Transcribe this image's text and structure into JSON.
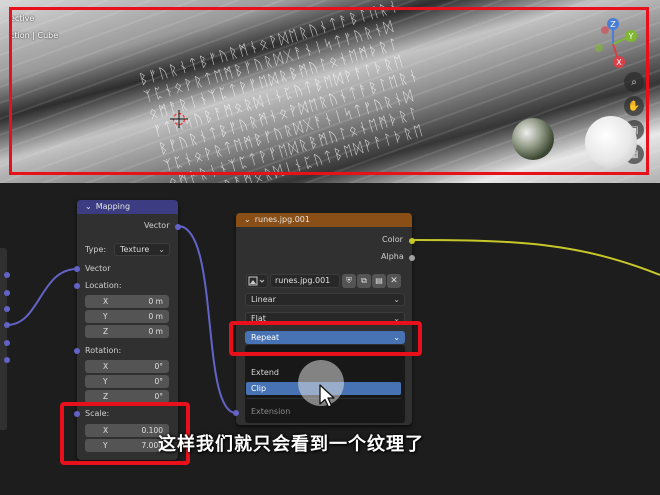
{
  "viewport": {
    "title": "ective",
    "subtitle": "ction | Cube",
    "runes_text": "ᛒᚠᚢᚱᚾᛏᛒᚠᚢᚱᛗᚾᛟᚹᛞᛖᚱᚢᚾᛏᚨᛒᛚᛖᚱᚾ\nᛉᛈᚾᛟᚹᚱᛏᛖᛗᛒᚠᚢᚱᛞᚷᚨᚾᛁᛋᛏᚠᚢᚱᚾᛞ\nᛟᛗᚨᚱᛁᚾᛉᛈᛏᚹᚠᛖᛞᚱᛒᛗᚢᛚᛟᚾᛖᛗᚦᚱᛚ\nᚠᛏᛖᛋᚢᛒᚨᛗᛟᚱᛞᛁᚾᛈᚢᛏᛒᛖᛞᚹᚨᛚᚦᚱᛖ\nᛒᚠᚢᚱᚾᛏᛒᚠᚢᚱᛗᚾᛟᚹᛞᛖᚱᚢᚾᛏᚨᛒᛚᛖᚱᚾ\nᛉᛈᚾᛟᚹᚱᛏᛖᛗᛒᚠᚢᚱᛞᚷᚨᚾᛁᛋᛏᚠᚢᚱᚾᛞ\nᛟᛗᚨᚱᛁᚾᛉᛈᛏᚹᚠᛖᛞᚱᛒᛗᚢᛚᛟᚾᛖᛗᚦᚱᛚ\nᚠᛏᛖᛋᚢᛒᚨᛗᛟᚱᛞᛁᚾᛈᚢᛏᛒᛖᛞᚹᚨᛚᚦᚱᛖ",
    "gizmo": {
      "x": "X",
      "y": "Y",
      "z": "Z"
    }
  },
  "mapping_node": {
    "title": "Mapping",
    "output": "Vector",
    "type_label": "Type:",
    "type_value": "Texture",
    "vector_input": "Vector",
    "location_label": "Location:",
    "location": [
      {
        "axis": "X",
        "value": "0 m"
      },
      {
        "axis": "Y",
        "value": "0 m"
      },
      {
        "axis": "Z",
        "value": "0 m"
      }
    ],
    "rotation_label": "Rotation:",
    "rotation": [
      {
        "axis": "X",
        "value": "0°"
      },
      {
        "axis": "Y",
        "value": "0°"
      },
      {
        "axis": "Z",
        "value": "0°"
      }
    ],
    "scale_label": "Scale:",
    "scale": [
      {
        "axis": "X",
        "value": "0.100"
      },
      {
        "axis": "Y",
        "value": "7.000"
      }
    ]
  },
  "image_node": {
    "title": "runes.jpg.001",
    "outputs": {
      "color": "Color",
      "alpha": "Alpha"
    },
    "image_name": "runes.jpg.001",
    "interpolation": "Linear",
    "projection": "Flat",
    "extension": "Repeat",
    "extension_label": "Extension",
    "extension_menu": [
      "Extend",
      "Clip"
    ]
  },
  "subtitle": "这样我们就只会看到一个纹理了",
  "colors": {
    "mapping_header": "#3c3c83",
    "image_header": "#8a4f16",
    "highlight": "#e8101a",
    "selected": "#4772b3"
  }
}
